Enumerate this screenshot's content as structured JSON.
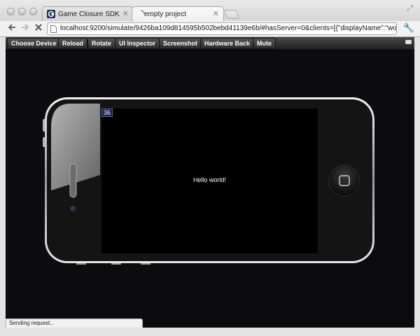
{
  "browser": {
    "tabs": [
      {
        "title": "Game Closure SDK",
        "active": false
      },
      {
        "title": "empty project",
        "active": true
      }
    ],
    "address": "localhost:9200/simulate/9426ba109d814595b502bebd41139e6b/#hasServer=0&clients=[{\"displayName\":\"woot\",\"..."
  },
  "toolbar": {
    "buttons": [
      "Choose Device",
      "Reload",
      "Rotate",
      "UI Inspector",
      "Screenshot",
      "Hardware Back",
      "Mute"
    ]
  },
  "simulator": {
    "fps_counter": "36",
    "screen_text": "Hello world!",
    "device_body_color": "#1a1a1a",
    "bezel_color": "#dcdcdc",
    "screen_color": "#000000"
  },
  "status_text": "Sending request...",
  "icons": [
    "back-arrow-icon",
    "forward-arrow-icon",
    "stop-icon",
    "page-icon",
    "wrench-icon",
    "fullscreen-icon",
    "close-icon",
    "home-button-icon"
  ]
}
